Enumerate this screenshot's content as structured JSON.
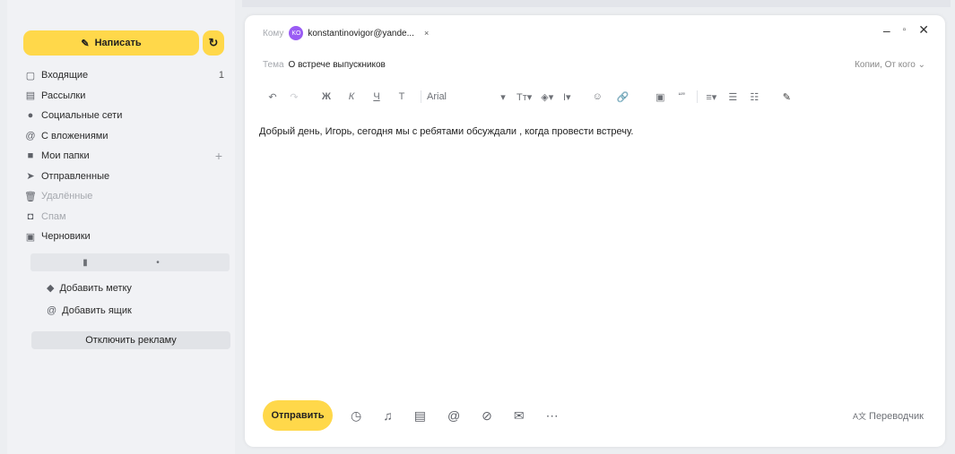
{
  "compose_button": "Написать",
  "refresh_icon": "refresh-icon",
  "nav": [
    {
      "label": "Входящие",
      "count": "1",
      "icon": "inbox-icon",
      "muted": false
    },
    {
      "label": "Рассылки",
      "count": "",
      "icon": "newsletter-icon",
      "muted": false
    },
    {
      "label": "Социальные сети",
      "count": "",
      "icon": "social-icon",
      "muted": false
    },
    {
      "label": "С вложениями",
      "count": "",
      "icon": "paperclip-icon",
      "muted": false
    },
    {
      "label": "Мои папки",
      "count": "",
      "icon": "folder-icon",
      "muted": false,
      "plus": "+"
    },
    {
      "label": "Отправленные",
      "count": "",
      "icon": "sent-icon",
      "muted": false
    },
    {
      "label": "Удалённые",
      "count": "",
      "icon": "trash-icon",
      "muted": true
    },
    {
      "label": "Спам",
      "count": "",
      "icon": "spam-icon",
      "muted": true
    },
    {
      "label": "Черновики",
      "count": "",
      "icon": "drafts-icon",
      "muted": false
    }
  ],
  "add_label": "Добавить метку",
  "add_mailbox": "Добавить ящик",
  "disable_ads": "Отключить рекламу",
  "compose": {
    "to_label": "Кому",
    "recipient_initials": "KO",
    "recipient_email": "konstantinovigor@yande...",
    "recipient_close": "×",
    "subject_label": "Тема",
    "subject": "О встрече выпускников",
    "copies_label": "Копии, От кого",
    "font_name": "Arial",
    "body": "Добрый день, Игорь, сегодня мы с ребятами обсуждали , когда провести встречу.",
    "send_label": "Отправить",
    "translator_label": "Переводчик"
  }
}
